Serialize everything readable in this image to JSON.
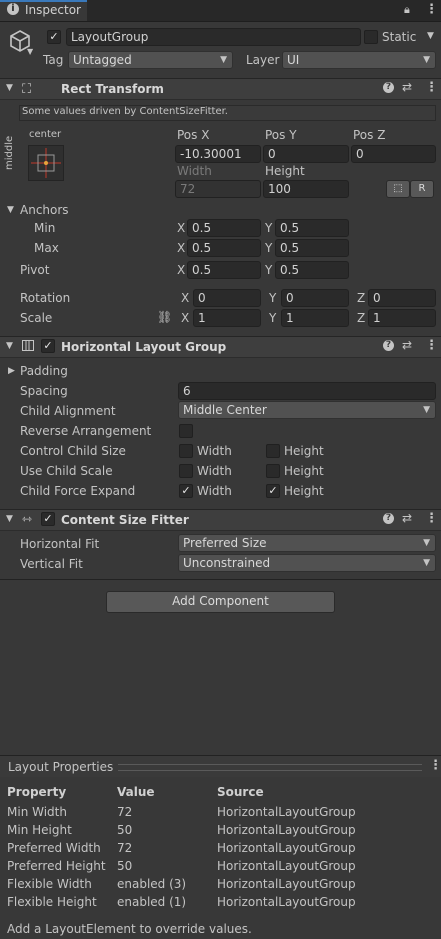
{
  "window": {
    "tab_title": "Inspector"
  },
  "gameobject": {
    "name": "LayoutGroup",
    "static_label": "Static",
    "tag_label": "Tag",
    "tag_value": "Untagged",
    "layer_label": "Layer",
    "layer_value": "UI"
  },
  "rect_transform": {
    "title": "Rect Transform",
    "notice": "Some values driven by ContentSizeFitter.",
    "anchor_h": "center",
    "anchor_v": "middle",
    "posx_label": "Pos X",
    "posx_value": "-10.30001",
    "posy_label": "Pos Y",
    "posy_value": "0",
    "posz_label": "Pos Z",
    "posz_value": "0",
    "width_label": "Width",
    "width_value": "72",
    "height_label": "Height",
    "height_value": "100",
    "r_button": "R",
    "anchors_label": "Anchors",
    "min_label": "Min",
    "min_x": "0.5",
    "min_y": "0.5",
    "max_label": "Max",
    "max_x": "0.5",
    "max_y": "0.5",
    "pivot_label": "Pivot",
    "pivot_x": "0.5",
    "pivot_y": "0.5",
    "rotation_label": "Rotation",
    "rot_x": "0",
    "rot_y": "0",
    "rot_z": "0",
    "scale_label": "Scale",
    "scale_x": "1",
    "scale_y": "1",
    "scale_z": "1",
    "x": "X",
    "y": "Y",
    "z": "Z"
  },
  "hlg": {
    "title": "Horizontal Layout Group",
    "padding_label": "Padding",
    "spacing_label": "Spacing",
    "spacing_value": "6",
    "alignment_label": "Child Alignment",
    "alignment_value": "Middle Center",
    "reverse_label": "Reverse Arrangement",
    "control_label": "Control Child Size",
    "usescale_label": "Use Child Scale",
    "expand_label": "Child Force Expand",
    "width": "Width",
    "height": "Height"
  },
  "csf": {
    "title": "Content Size Fitter",
    "hfit_label": "Horizontal Fit",
    "hfit_value": "Preferred Size",
    "vfit_label": "Vertical Fit",
    "vfit_value": "Unconstrained"
  },
  "add_component": "Add Component",
  "layout_properties": {
    "title": "Layout Properties",
    "headers": [
      "Property",
      "Value",
      "Source"
    ],
    "rows": [
      [
        "Min Width",
        "72",
        "HorizontalLayoutGroup"
      ],
      [
        "Min Height",
        "50",
        "HorizontalLayoutGroup"
      ],
      [
        "Preferred Width",
        "72",
        "HorizontalLayoutGroup"
      ],
      [
        "Preferred Height",
        "50",
        "HorizontalLayoutGroup"
      ],
      [
        "Flexible Width",
        "enabled (3)",
        "HorizontalLayoutGroup"
      ],
      [
        "Flexible Height",
        "enabled (1)",
        "HorizontalLayoutGroup"
      ]
    ],
    "footer": "Add a LayoutElement to override values."
  },
  "colors": {
    "accent": "#3a79bb",
    "background": "#383838",
    "header": "#3e3e3e"
  }
}
